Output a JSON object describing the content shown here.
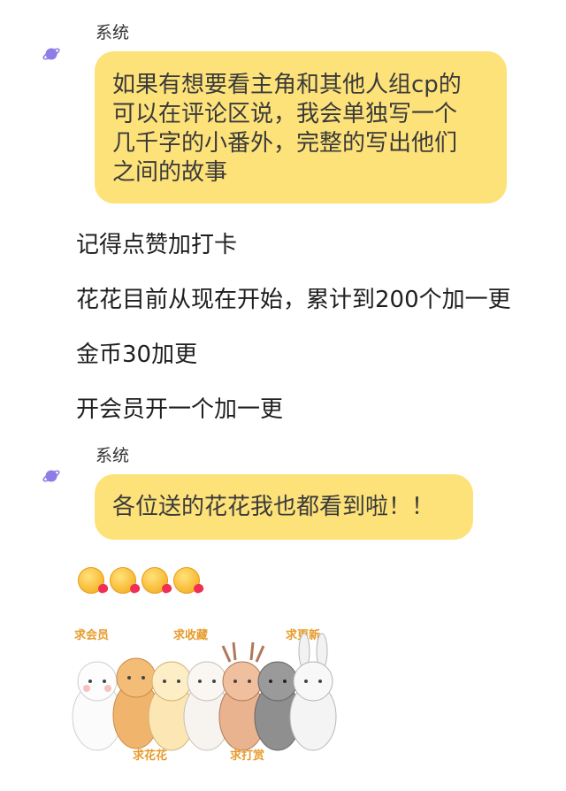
{
  "message1": {
    "sender": "系统",
    "lines": [
      "如果有想要看主角和其他人组cp的",
      "可以在评论区说，我会单独写一个",
      "几千字的小番外，完整的写出他们",
      "之间的故事"
    ]
  },
  "plain_lines": [
    "记得点赞加打卡",
    "花花目前从现在开始，累计到200个加一更",
    "金币30加更",
    "开会员开一个加一更"
  ],
  "message2": {
    "sender": "系统",
    "text": "各位送的花花我也都看到啦！！"
  },
  "emoji_row": [
    "kissing-heart-emoji",
    "kissing-heart-emoji",
    "kissing-heart-emoji",
    "kissing-heart-emoji"
  ],
  "sticker": {
    "captions": [
      "求会员",
      "求收藏",
      "求更新",
      "求花花",
      "求打赏"
    ]
  },
  "colors": {
    "bubble": "#fde27a",
    "avatar": "#8f7ce6"
  }
}
